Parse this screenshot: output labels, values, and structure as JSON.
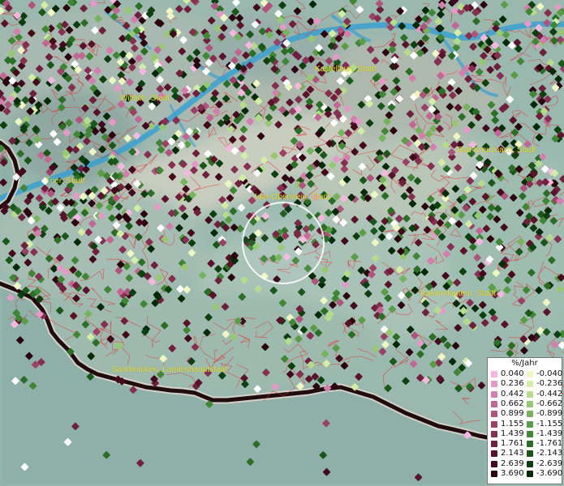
{
  "map": {
    "cities": [
      {
        "id": "kastellaun",
        "label": "Kastellaun, Stadt"
      },
      {
        "id": "wittlich",
        "label": "Wittlich, Stadt"
      },
      {
        "id": "bad-kreuznach",
        "label": "Bad Kreuznach, Stadt"
      },
      {
        "id": "trier",
        "label": "Trier, Stadt"
      },
      {
        "id": "idar-oberstein",
        "label": "Idar-Oberstein, Stadt"
      },
      {
        "id": "kaiserslautern",
        "label": "Kaiserslautern, Stadt"
      },
      {
        "id": "saarbruecken",
        "label": "Saarbrücken, Landeshauptstadt"
      }
    ],
    "focus_marker": "selection-circle"
  },
  "legend": {
    "title": "%/Jahr",
    "positive": [
      {
        "value": "0.040",
        "color": "#f4b8df"
      },
      {
        "value": "0.236",
        "color": "#e39ac6"
      },
      {
        "value": "0.442",
        "color": "#d27fae"
      },
      {
        "value": "0.662",
        "color": "#c06893"
      },
      {
        "value": "0.899",
        "color": "#ad557c"
      },
      {
        "value": "1.155",
        "color": "#9a4166"
      },
      {
        "value": "1.439",
        "color": "#852f51"
      },
      {
        "value": "1.761",
        "color": "#6f203c"
      },
      {
        "value": "2.143",
        "color": "#59142b"
      },
      {
        "value": "2.639",
        "color": "#430a1d"
      },
      {
        "value": "3.690",
        "color": "#2b0410"
      }
    ],
    "negative": [
      {
        "value": "-0.040",
        "color": "#eef6c4"
      },
      {
        "value": "-0.236",
        "color": "#d3eca6"
      },
      {
        "value": "-0.442",
        "color": "#b5dc8c"
      },
      {
        "value": "-0.662",
        "color": "#96c874"
      },
      {
        "value": "-0.899",
        "color": "#77b25d"
      },
      {
        "value": "-1.155",
        "color": "#5b9c49"
      },
      {
        "value": "-1.439",
        "color": "#418537"
      },
      {
        "value": "-1.761",
        "color": "#2c6d28"
      },
      {
        "value": "-2.143",
        "color": "#1b561b"
      },
      {
        "value": "-2.639",
        "color": "#0e3f10"
      },
      {
        "value": "-3.690",
        "color": "#052a07"
      }
    ]
  }
}
